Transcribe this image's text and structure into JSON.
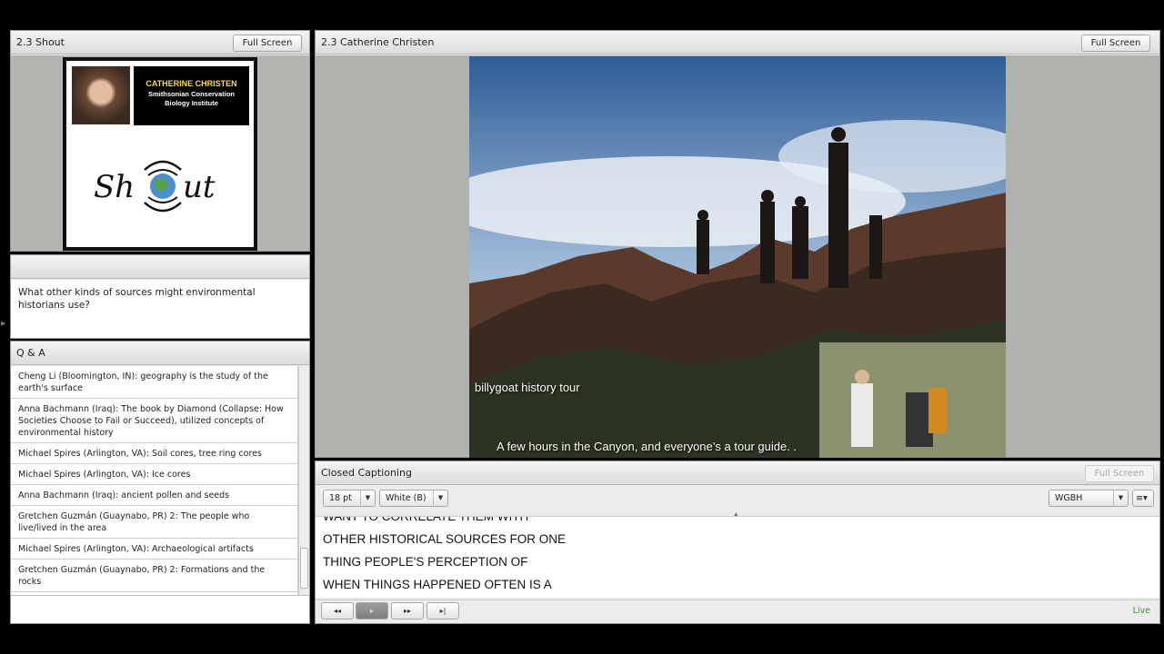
{
  "shout_pod": {
    "title": "2.3 Shout",
    "fullscreen_label": "Full Screen",
    "speaker_name": "CATHERINE CHRISTEN",
    "speaker_org_line1": "Smithsonian Conservation",
    "speaker_org_line2": "Biology Institute",
    "logo_text": "SHOUT"
  },
  "note_pod": {
    "question": "What other kinds of sources might environmental historians use?"
  },
  "qa_pod": {
    "title": "Q & A",
    "items": [
      "Cheng Li (Bloomington, IN): geography is the study of the earth's surface",
      "Anna Bachmann (Iraq): The book by Diamond (Collapse: How Societies Choose to Fail or Succeed), utilized concepts of environmental history",
      "Michael Spires (Arlington, VA): Soil cores, tree ring cores",
      "Michael Spires (Arlington, VA): Ice cores",
      "Anna Bachmann (Iraq): ancient pollen and seeds",
      "Gretchen Guzmán (Guaynabo, PR) 2: The people who live/lived in the area",
      "Michael Spires (Arlington, VA): Archaeological artifacts",
      "Gretchen Guzmán (Guaynabo, PR) 2: Formations and the rocks"
    ]
  },
  "main_pod": {
    "title": "2.3 Catherine Christen",
    "fullscreen_label": "Full Screen",
    "photo_title": "billygoat history tour",
    "video_caption": "A few hours in the Canyon, and everyone’s a tour guide. ."
  },
  "cc_pod": {
    "title": "Closed Captioning",
    "fullscreen_label": "Full Screen",
    "font_size": "18 pt",
    "color": "White (B)",
    "source": "WGBH",
    "lines": [
      "WANT TO CORRELATE THEM WITH",
      "OTHER HISTORICAL SOURCES FOR ONE",
      "THING PEOPLE'S PERCEPTION OF",
      "WHEN THINGS HAPPENED OFTEN IS A"
    ],
    "controls": {
      "rewind": "◂◂",
      "play": "▸",
      "forward": "▸▸",
      "end": "▸|"
    },
    "status": "Live"
  }
}
